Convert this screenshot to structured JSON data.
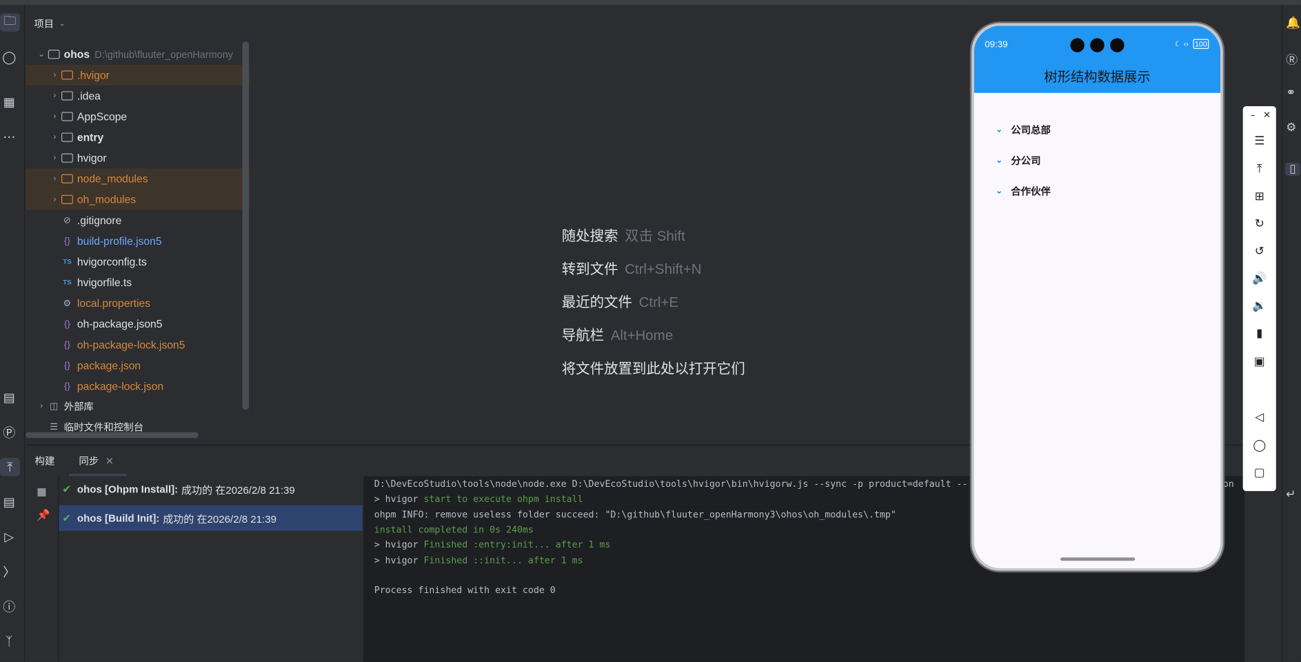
{
  "project_panel": {
    "title": "项目",
    "root": {
      "name": "ohos",
      "path": "D:\\github\\fluuter_openHarmony"
    },
    "items": [
      {
        "label": ".hvigor",
        "kind": "folder",
        "style": "orange",
        "highlight": true
      },
      {
        "label": ".idea",
        "kind": "folder",
        "style": "white",
        "highlight": false
      },
      {
        "label": "AppScope",
        "kind": "folder",
        "style": "white",
        "highlight": false
      },
      {
        "label": "entry",
        "kind": "module",
        "style": "white-bold",
        "highlight": false
      },
      {
        "label": "hvigor",
        "kind": "folder",
        "style": "white",
        "highlight": false
      },
      {
        "label": "node_modules",
        "kind": "folder",
        "style": "orange",
        "highlight": true
      },
      {
        "label": "oh_modules",
        "kind": "folder",
        "style": "orange",
        "highlight": true
      },
      {
        "label": ".gitignore",
        "kind": "ignore",
        "style": "white",
        "highlight": false
      },
      {
        "label": "build-profile.json5",
        "kind": "json",
        "style": "blue",
        "highlight": false
      },
      {
        "label": "hvigorconfig.ts",
        "kind": "ts",
        "style": "white",
        "highlight": false
      },
      {
        "label": "hvigorfile.ts",
        "kind": "ts",
        "style": "white",
        "highlight": false
      },
      {
        "label": "local.properties",
        "kind": "gear",
        "style": "orange",
        "highlight": false
      },
      {
        "label": "oh-package.json5",
        "kind": "json",
        "style": "white",
        "highlight": false
      },
      {
        "label": "oh-package-lock.json5",
        "kind": "json",
        "style": "orange",
        "highlight": false
      },
      {
        "label": "package.json",
        "kind": "json",
        "style": "orange",
        "highlight": false
      },
      {
        "label": "package-lock.json",
        "kind": "json",
        "style": "orange",
        "highlight": false
      }
    ],
    "external_libs": "外部库",
    "scratches": "临时文件和控制台"
  },
  "editor_hints": [
    {
      "text": "随处搜索",
      "key": "双击 Shift"
    },
    {
      "text": "转到文件",
      "key": "Ctrl+Shift+N"
    },
    {
      "text": "最近的文件",
      "key": "Ctrl+E"
    },
    {
      "text": "导航栏",
      "key": "Alt+Home"
    },
    {
      "text": "将文件放置到此处以打开它们",
      "key": ""
    }
  ],
  "build_panel": {
    "tab_build": "构建",
    "tab_sync": "同步",
    "items": [
      {
        "title": "ohos [Ohpm Install]:",
        "status": "成功的 在2026/2/8 21:39"
      },
      {
        "title": "ohos [Build Init]:",
        "status": "成功的 在2026/2/8 21:39"
      }
    ],
    "console": [
      {
        "prefix": "D:\\DevEcoStudio\\tools\\node\\node.exe D:\\DevEcoStudio\\tools\\hvigor\\bin\\hvigorw.js --sync -p product=default --",
        "green": "",
        "suffix": "on"
      },
      {
        "prefix": "> hvigor ",
        "green": "start to execute ohpm install",
        "suffix": ""
      },
      {
        "prefix": "ohpm INFO: remove useless folder succeed: \"D:\\github\\fluuter_openHarmony3\\ohos\\oh_modules\\.tmp\"",
        "green": "",
        "suffix": ""
      },
      {
        "prefix": "",
        "green": "install completed in 0s 240ms",
        "suffix": ""
      },
      {
        "prefix": "> hvigor ",
        "green": "Finished :entry:init... after 1 ms",
        "suffix": ""
      },
      {
        "prefix": "> hvigor ",
        "green": "Finished ::init... after 1 ms",
        "suffix": ""
      },
      {
        "prefix": "",
        "green": "",
        "suffix": ""
      },
      {
        "prefix": "Process finished with exit code 0",
        "green": "",
        "suffix": ""
      }
    ]
  },
  "phone": {
    "time": "09:39",
    "battery": "100",
    "app_title": "树形结构数据展示",
    "nodes": [
      "公司总部",
      "分公司",
      "合作伙伴"
    ]
  },
  "colors": {
    "accent": "#2196f3",
    "success": "#57a863",
    "orange_text": "#d78a3f",
    "blue_text": "#6fa8ff",
    "selection": "#2e436e"
  }
}
